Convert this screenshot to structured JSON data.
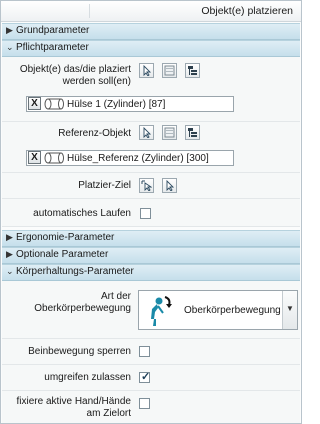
{
  "window": {
    "title": "Objekt(e) platzieren"
  },
  "sections": {
    "grundparameter": {
      "label": "Grundparameter",
      "expanded": false
    },
    "pflichtparameter": {
      "label": "Pflichtparameter",
      "expanded": true
    },
    "ergonomie": {
      "label": "Ergonomie-Parameter",
      "expanded": false
    },
    "optionale": {
      "label": "Optionale Parameter",
      "expanded": false
    },
    "koerperhaltung": {
      "label": "Körperhaltungs-Parameter",
      "expanded": true
    }
  },
  "pflicht": {
    "objects_label_1": "Objekt(e) das/die plaziert",
    "objects_label_2": "werden soll(en)",
    "objects_value": "Hülse 1 (Zylinder) [87]",
    "reference_label": "Referenz-Objekt",
    "reference_value": "Hülse_Referenz (Zylinder) [300]",
    "target_label": "Platzier-Ziel",
    "auto_label": "automatisches Laufen",
    "auto_checked": false,
    "remove_symbol": "X"
  },
  "koerper": {
    "upper_label_1": "Art der",
    "upper_label_2": "Oberkörperbewegung",
    "upper_value": "Oberkörperbewegung (",
    "leg_label": "Beinbewegung sperren",
    "leg_checked": false,
    "regrip_label": "umgreifen zulassen",
    "regrip_checked": true,
    "fix_label_1": "fixiere aktive Hand/Hände",
    "fix_label_2": "am Zielort",
    "fix_checked": false,
    "check_symbol": "✓"
  },
  "icons": {
    "collapsed": "triangle-right",
    "expanded": "chevron-down",
    "dropdown": "triangle-down",
    "colors": {
      "section_bg": "#c5dfeb",
      "accent": "#1d3e57",
      "figure": "#1a8aa8"
    }
  }
}
